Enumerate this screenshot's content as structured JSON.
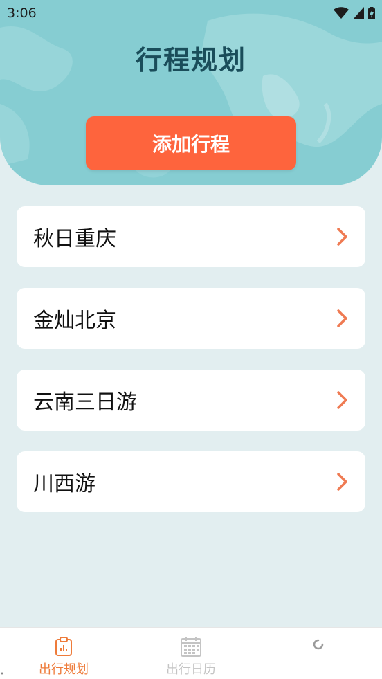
{
  "status_bar": {
    "time": "3:06"
  },
  "header": {
    "title": "行程规划",
    "add_button_label": "添加行程"
  },
  "trips": [
    {
      "label": "秋日重庆"
    },
    {
      "label": "金灿北京"
    },
    {
      "label": "云南三日游"
    },
    {
      "label": "川西游"
    }
  ],
  "tabs": [
    {
      "label": "出行规划",
      "active": true
    },
    {
      "label": "出行日历",
      "active": false
    },
    {
      "label": "",
      "active": false
    }
  ],
  "colors": {
    "header_bg": "#86cdd2",
    "title": "#1a4d5a",
    "accent_button": "#fe643d",
    "chevron": "#ef7a52",
    "active_tab": "#ee7b3a",
    "inactive_tab": "#c4c4c4",
    "page_bg": "#e2eef0"
  }
}
